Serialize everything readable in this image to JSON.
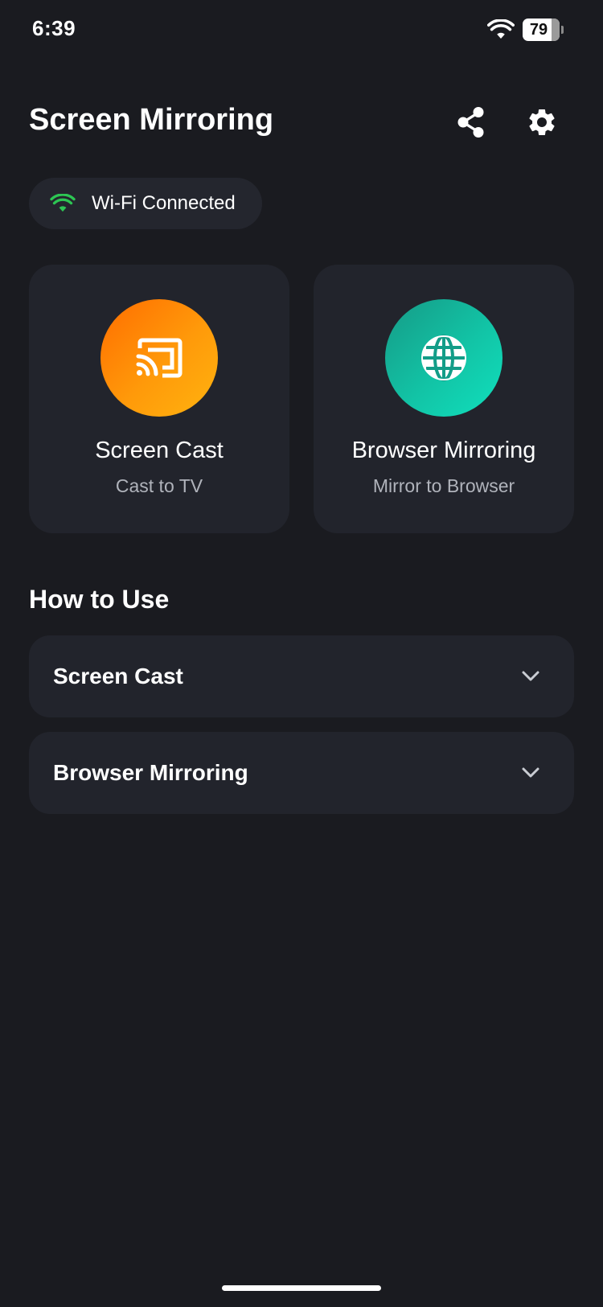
{
  "status_bar": {
    "time": "6:39",
    "battery_percent": 79,
    "battery_label": "79"
  },
  "header": {
    "title": "Screen Mirroring"
  },
  "wifi_status": {
    "label": "Wi-Fi Connected",
    "icon": "wifi-icon",
    "color": "#2dc653"
  },
  "cards": [
    {
      "title": "Screen Cast",
      "subtitle": "Cast to TV",
      "icon": "cast-icon",
      "accent_start": "#ff6d00",
      "accent_end": "#ffb30f"
    },
    {
      "title": "Browser Mirroring",
      "subtitle": "Mirror to Browser",
      "icon": "globe-icon",
      "accent_start": "#169a86",
      "accent_end": "#10e0bd"
    }
  ],
  "how_to_use": {
    "title": "How to Use",
    "items": [
      {
        "label": "Screen Cast",
        "icon": "chevron-down-icon"
      },
      {
        "label": "Browser Mirroring",
        "icon": "chevron-down-icon"
      }
    ]
  },
  "colors": {
    "background": "#1a1b20",
    "card": "#22242c",
    "pill": "#24262e",
    "text": "#ffffff",
    "subtext": "#b0b3bb"
  }
}
